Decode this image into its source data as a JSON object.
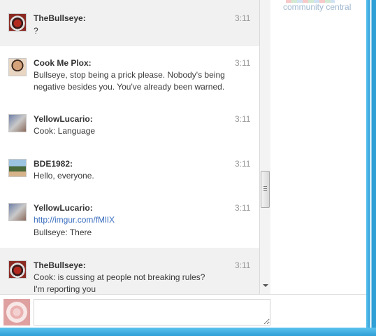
{
  "community_label": "community central",
  "messages": [
    {
      "user": "TheBullseye:",
      "time": "3:11",
      "lines": [
        "?"
      ],
      "avatar_icon": "bullseye-avatar-icon",
      "shaded": true
    },
    {
      "user": "Cook Me Plox:",
      "time": "3:11",
      "lines": [
        "Bullseye, stop being a prick please. Nobody's being",
        "negative besides you. You've already been warned."
      ],
      "avatar_icon": "cook-avatar-icon",
      "shaded": false
    },
    {
      "user": "YellowLucario:",
      "time": "3:11",
      "lines": [
        "Cook: Language"
      ],
      "avatar_icon": "lucario-avatar-icon",
      "shaded": false
    },
    {
      "user": "BDE1982:",
      "time": "3:11",
      "lines": [
        "Hello, everyone."
      ],
      "avatar_icon": "bde-avatar-icon",
      "shaded": false
    },
    {
      "user": "YellowLucario:",
      "time": "3:11",
      "link": "http://imgur.com/fMlIX",
      "lines": [
        "Bullseye: There"
      ],
      "avatar_icon": "lucario-avatar-icon",
      "shaded": false
    },
    {
      "user": "TheBullseye:",
      "time": "3:11",
      "lines": [
        "Cook: is cussing at people not breaking rules?",
        "I'm reporting you"
      ],
      "avatar_icon": "bullseye-avatar-icon",
      "shaded": true
    }
  ],
  "input": {
    "value": "",
    "placeholder": ""
  },
  "colors": {
    "frame": "#2f9fd6",
    "link": "#3a6dbf",
    "shaded_row": "#f1f1f1"
  }
}
